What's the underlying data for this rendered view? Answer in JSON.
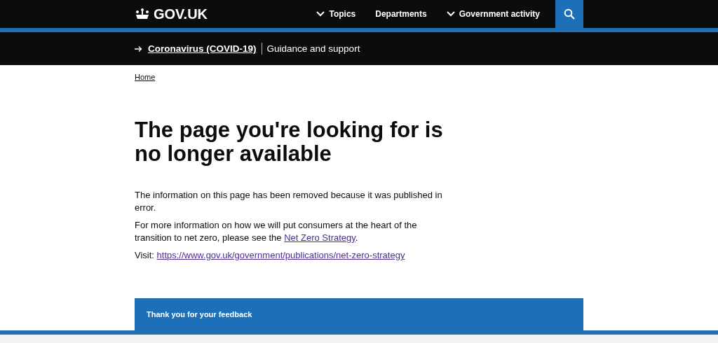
{
  "header": {
    "logo": "GOV.UK",
    "nav": [
      {
        "label": "Topics",
        "kind": "dropdown"
      },
      {
        "label": "Departments",
        "kind": "link"
      },
      {
        "label": "Government activity",
        "kind": "dropdown"
      }
    ]
  },
  "banner": {
    "link": "Coronavirus (COVID-19)",
    "text": "Guidance and support"
  },
  "breadcrumb": [
    "Home"
  ],
  "title": "The page you're looking for is no longer available",
  "paragraphs": [
    [
      {
        "kind": "text",
        "text": "The information on this page has been removed because it was published in error."
      }
    ],
    [
      {
        "kind": "text",
        "text": "For more information on how we will put consumers at the heart of the transition to net zero, please see the "
      },
      {
        "kind": "link",
        "text": "Net Zero Strategy"
      },
      {
        "kind": "text",
        "text": "."
      }
    ],
    [
      {
        "kind": "text",
        "text": "Visit: "
      },
      {
        "kind": "link",
        "text": "https://www.gov.uk/government/publications/net-zero-strategy"
      }
    ]
  ],
  "feedback": "Thank you for your feedback"
}
